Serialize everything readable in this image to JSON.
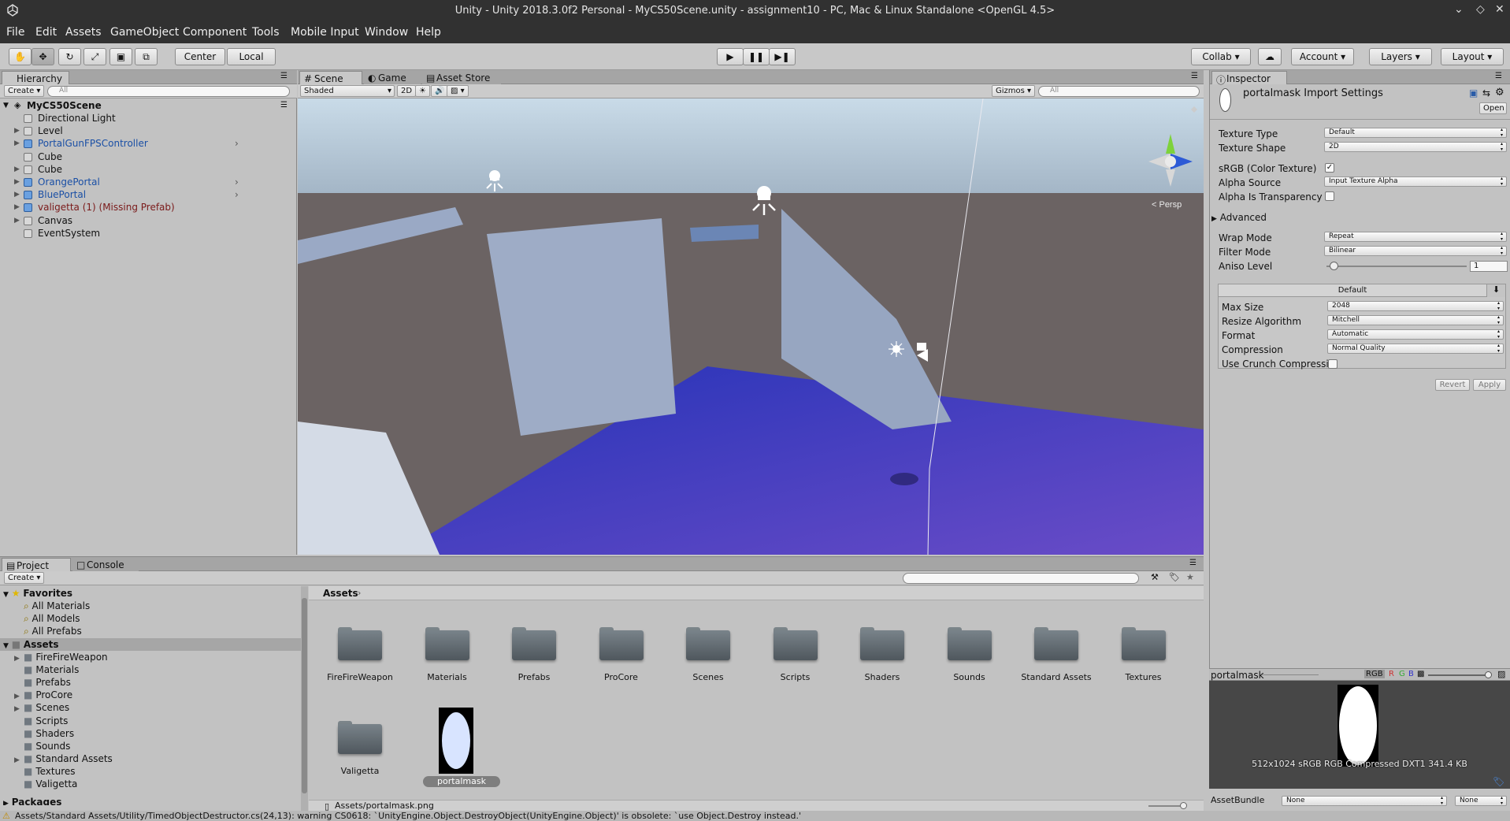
{
  "title_bar": {
    "title": "Unity - Unity 2018.3.0f2 Personal - MyCS50Scene.unity - assignment10 - PC, Mac & Linux Standalone <OpenGL 4.5>"
  },
  "menu": [
    "File",
    "Edit",
    "Assets",
    "GameObject",
    "Component",
    "Tools",
    "Mobile Input",
    "Window",
    "Help"
  ],
  "toolbar": {
    "pivot": "Center",
    "space": "Local",
    "collab": "Collab",
    "account": "Account",
    "layers": "Layers",
    "layout": "Layout"
  },
  "hierarchy": {
    "tab": "Hierarchy",
    "create": "Create",
    "search_placeholder": "All",
    "scene": "MyCS50Scene",
    "items": [
      {
        "label": "Directional Light",
        "color": "#111111"
      },
      {
        "label": "Level",
        "color": "#111111"
      },
      {
        "label": "PortalGunFPSController",
        "color": "#1a4fa5"
      },
      {
        "label": "Cube",
        "color": "#111111"
      },
      {
        "label": "Cube",
        "color": "#111111"
      },
      {
        "label": "OrangePortal",
        "color": "#1a4fa5"
      },
      {
        "label": "BluePortal",
        "color": "#1a4fa5"
      },
      {
        "label": "valigetta (1) (Missing Prefab)",
        "color": "#7a1a1a"
      },
      {
        "label": "Canvas",
        "color": "#111111"
      },
      {
        "label": "EventSystem",
        "color": "#111111"
      }
    ]
  },
  "scene_view": {
    "tabs": [
      "Scene",
      "Game",
      "Asset Store"
    ],
    "shading": "Shaded",
    "mode_2d": "2D",
    "gizmos": "Gizmos",
    "search_placeholder": "All",
    "projection": "< Persp"
  },
  "inspector": {
    "tab": "Inspector",
    "asset_title": "portalmask Import Settings",
    "open_button": "Open",
    "fields": {
      "texture_type": {
        "label": "Texture Type",
        "value": "Default"
      },
      "texture_shape": {
        "label": "Texture Shape",
        "value": "2D"
      },
      "srgb": {
        "label": "sRGB (Color Texture)",
        "checked": true
      },
      "alpha_source": {
        "label": "Alpha Source",
        "value": "Input Texture Alpha"
      },
      "alpha_transparency": {
        "label": "Alpha Is Transparency",
        "checked": false
      },
      "advanced": "Advanced",
      "wrap_mode": {
        "label": "Wrap Mode",
        "value": "Repeat"
      },
      "filter_mode": {
        "label": "Filter Mode",
        "value": "Bilinear"
      },
      "aniso_level": {
        "label": "Aniso Level",
        "value": "1"
      }
    },
    "platform_tab": "Default",
    "platform": {
      "max_size": {
        "label": "Max Size",
        "value": "2048"
      },
      "resize": {
        "label": "Resize Algorithm",
        "value": "Mitchell"
      },
      "format": {
        "label": "Format",
        "value": "Automatic"
      },
      "compression": {
        "label": "Compression",
        "value": "Normal Quality"
      },
      "crunch": {
        "label": "Use Crunch Compressio",
        "checked": false
      }
    },
    "revert": "Revert",
    "apply": "Apply"
  },
  "preview": {
    "name": "portalmask",
    "channel": "RGB",
    "info": "512x1024 sRGB  RGB Compressed DXT1   341.4 KB",
    "assetbundle_label": "AssetBundle",
    "assetbundle_value": "None",
    "variant_value": "None"
  },
  "project": {
    "tabs": [
      "Project",
      "Console"
    ],
    "create": "Create",
    "favorites_label": "Favorites",
    "favorites": [
      "All Materials",
      "All Models",
      "All Prefabs"
    ],
    "assets_label": "Assets",
    "tree": [
      {
        "label": "FireFireWeapon",
        "expandable": true
      },
      {
        "label": "Materials",
        "expandable": false
      },
      {
        "label": "Prefabs",
        "expandable": false
      },
      {
        "label": "ProCore",
        "expandable": true
      },
      {
        "label": "Scenes",
        "expandable": true
      },
      {
        "label": "Scripts",
        "expandable": false
      },
      {
        "label": "Shaders",
        "expandable": false
      },
      {
        "label": "Sounds",
        "expandable": false
      },
      {
        "label": "Standard Assets",
        "expandable": true
      },
      {
        "label": "Textures",
        "expandable": false
      },
      {
        "label": "Valigetta",
        "expandable": false
      }
    ],
    "packages_label": "Packages",
    "breadcrumb": "Assets",
    "grid": [
      "FireFireWeapon",
      "Materials",
      "Prefabs",
      "ProCore",
      "Scenes",
      "Scripts",
      "Shaders",
      "Sounds",
      "Standard Assets",
      "Textures",
      "Valigetta"
    ],
    "selected_asset": "portalmask",
    "selected_path": "Assets/portalmask.png"
  },
  "status": {
    "message": "Assets/Standard Assets/Utility/TimedObjectDestructor.cs(24,13): warning CS0618: `UnityEngine.Object.DestroyObject(UnityEngine.Object)' is obsolete: `use Object.Destroy instead.'"
  }
}
